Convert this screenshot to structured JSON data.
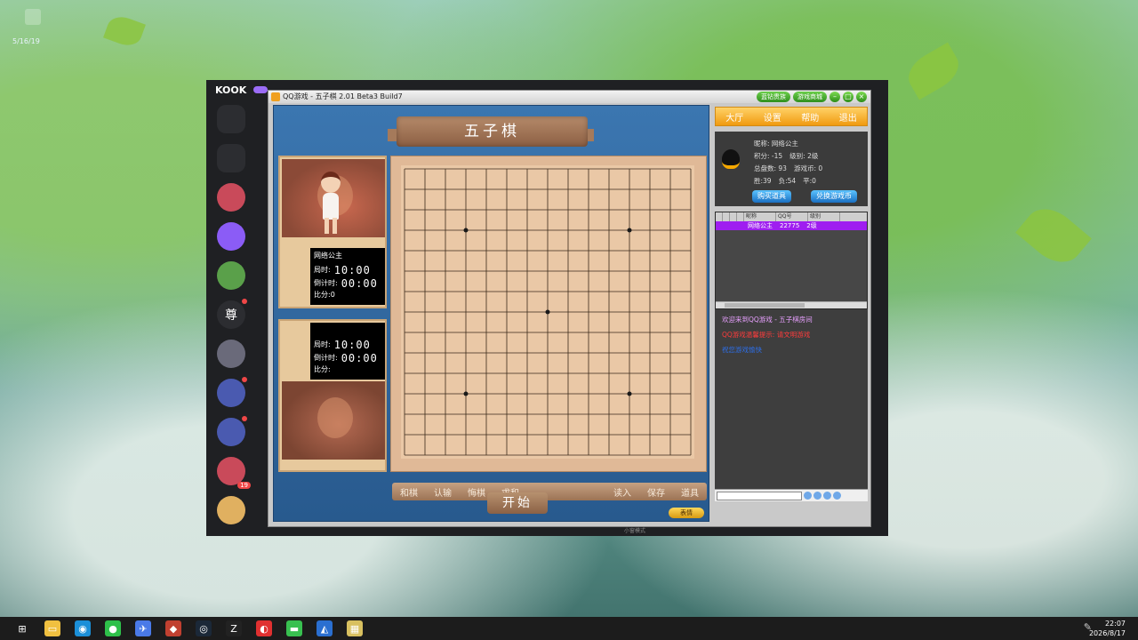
{
  "desktop": {
    "stamp": "5/16/19"
  },
  "kook": {
    "logo": "KOOK",
    "servers": [
      {
        "icon": "message-icon",
        "color": "#2c2d31"
      },
      {
        "icon": "sparkle-icon",
        "color": "#2c2d31"
      },
      {
        "icon": "avatar-red",
        "color": "#c94a5a"
      },
      {
        "icon": "avatar-purple",
        "color": "#8b5cf6"
      },
      {
        "icon": "avatar-green",
        "color": "#5aa04a"
      },
      {
        "icon": "zun-text",
        "label": "尊",
        "color": "#2c2d31"
      },
      {
        "icon": "avatar-anime",
        "color": "#6a6a7a"
      },
      {
        "icon": "avatar-blue1",
        "color": "#4a5ab0"
      },
      {
        "icon": "avatar-blue2",
        "color": "#4a5ab0"
      },
      {
        "icon": "avatar-badge",
        "badge": "19",
        "color": "#c94a5a"
      },
      {
        "icon": "avatar-user",
        "color": "#e0b060"
      }
    ],
    "footer": "小窗模式"
  },
  "qq": {
    "title": "QQ游戏 - 五子棋   2.01 Beta3 Build7",
    "top_buttons": [
      "蓝钻贵族",
      "游戏商城"
    ],
    "game_title": "五子棋",
    "player1": {
      "name": "网络公主",
      "label_step": "局时:",
      "step_time": "10:00",
      "label_count": "倒计时:",
      "count_time": "00:00",
      "score": "比分:0"
    },
    "player2": {
      "label_step": "局时:",
      "step_time": "10:00",
      "label_count": "倒计时:",
      "count_time": "00:00",
      "score": "比分:"
    },
    "bottom_left": [
      "和棋",
      "认输",
      "悔棋",
      "求和"
    ],
    "bottom_right": [
      "读入",
      "保存",
      "道具"
    ],
    "start": "开始",
    "emote": "表情",
    "menu": [
      "大厅",
      "设置",
      "帮助",
      "退出"
    ],
    "info": {
      "nickname": "昵称: 网络公主",
      "points": "积分: -15",
      "level": "级别: 2级",
      "total": "总盘数: 93",
      "coins": "游戏币: 0",
      "record_win": "胜:39",
      "record_lose": "负:54",
      "record_draw": "平:0",
      "buy": "购买道具",
      "exchange": "兑换游戏币"
    },
    "list": {
      "headers": [
        "",
        "",
        "",
        "",
        "昵称",
        "QQ号",
        "级别"
      ],
      "row": {
        "name": "网络公主",
        "qq": "22775",
        "level": "2级"
      }
    },
    "chat": {
      "line1": "欢迎来到QQ游戏 - 五子棋房间",
      "line2": "QQ游戏温馨提示: 请文明游戏",
      "line3": "祝您游戏愉快"
    }
  },
  "taskbar": {
    "icons": [
      "windows-icon",
      "explorer-icon",
      "edge-icon",
      "wechat-icon",
      "feishu-icon",
      "game-icon",
      "steam-icon",
      "z-icon",
      "netease-icon",
      "line-icon",
      "penguin-icon",
      "gomoku-icon"
    ],
    "time": "22:07",
    "date": "2026/8/17"
  },
  "board": {
    "size": 15,
    "stars": [
      [
        3,
        3
      ],
      [
        3,
        11
      ],
      [
        7,
        7
      ],
      [
        11,
        3
      ],
      [
        11,
        11
      ]
    ]
  }
}
